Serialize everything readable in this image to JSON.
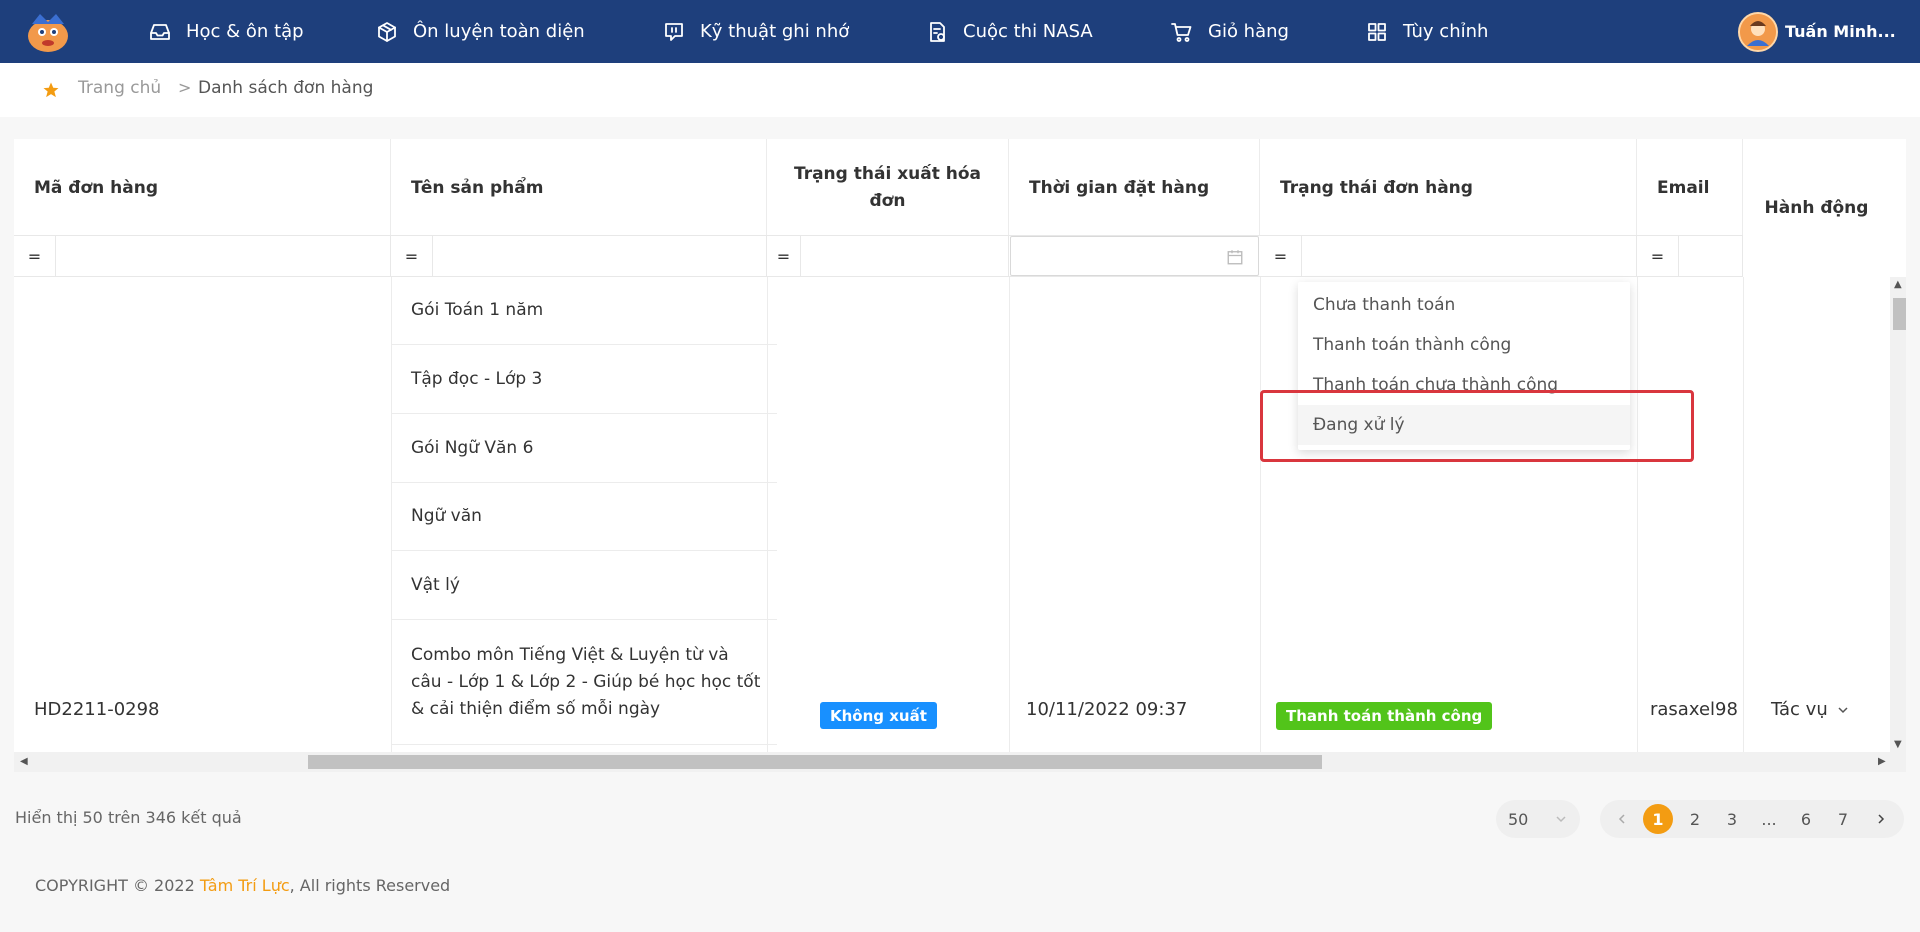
{
  "nav": {
    "items": [
      {
        "label": "Học & ôn tập",
        "icon": "inbox-icon"
      },
      {
        "label": "Ôn luyện toàn diện",
        "icon": "cube-icon"
      },
      {
        "label": "Kỹ thuật ghi nhớ",
        "icon": "message-icon"
      },
      {
        "label": "Cuộc thi NASA",
        "icon": "document-icon"
      },
      {
        "label": "Giỏ hàng",
        "icon": "cart-icon"
      },
      {
        "label": "Tùy chỉnh",
        "icon": "grid-icon"
      }
    ],
    "user_name": "Tuấn Minh..."
  },
  "breadcrumb": {
    "home": "Trang chủ",
    "separator": ">",
    "current": "Danh sách đơn hàng"
  },
  "table": {
    "columns": [
      "Mã đơn hàng",
      "Tên sản phẩm",
      "Trạng thái xuất hóa đơn",
      "Thời gian đặt hàng",
      "Trạng thái đơn hàng",
      "Email",
      "Hành động"
    ],
    "filter_operator": "=",
    "products": [
      "Gói Toán 1 năm",
      "Tập đọc - Lớp 3",
      "Gói Ngữ Văn 6",
      "Ngữ văn",
      "Vật lý",
      "Combo môn Tiếng Việt & Luyện từ và câu - Lớp 1 & Lớp 2 - Giúp bé học học tốt & cải thiện điểm số mỗi ngày"
    ],
    "row": {
      "order_id": "HD2211-0298",
      "invoice_status": "Không xuất",
      "order_time": "10/11/2022 09:37",
      "order_status": "Thanh toán thành công",
      "email": "rasaxel98",
      "action": "Tác vụ"
    }
  },
  "status_dropdown": {
    "options": [
      "Chưa thanh toán",
      "Thanh toán thành công",
      "Thanh toán chưa thành công",
      "Đang xử lý"
    ],
    "highlighted": "Đang xử lý"
  },
  "footer": {
    "showing": "Hiển thị 50 trên 346 kết quả",
    "page_size": "50",
    "pages": [
      "1",
      "2",
      "3",
      "...",
      "6",
      "7"
    ],
    "current_page": "1",
    "copyright_prefix": "COPYRIGHT © 2022 ",
    "brand": "Tâm Trí Lực",
    "copyright_suffix": ", All rights Reserved"
  },
  "colors": {
    "nav_bg": "#1e3f7c",
    "accent": "#f39c12",
    "tag_blue": "#1890ff",
    "tag_green": "#52c41a",
    "highlight_border": "#d9363e"
  }
}
